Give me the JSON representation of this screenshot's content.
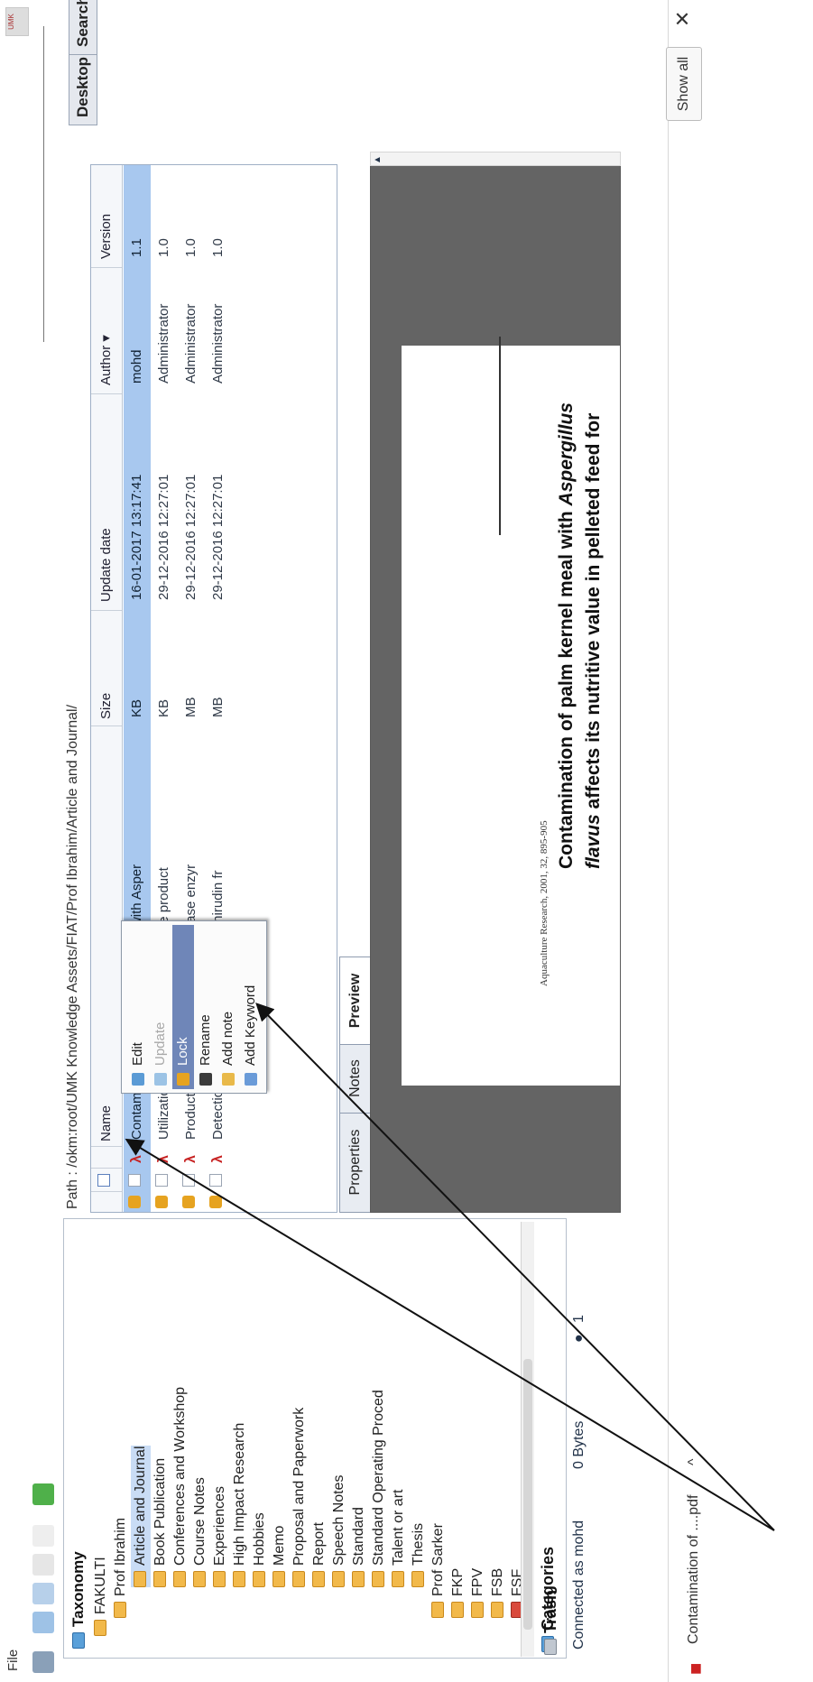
{
  "menubar": {
    "file": "File"
  },
  "topnav": {
    "desktop": "Desktop",
    "search": "Search"
  },
  "tree": {
    "title": "Taxonomy",
    "items": [
      {
        "label": "FAKULTI",
        "depth": 0
      },
      {
        "label": "Prof Ibrahim",
        "depth": 1
      },
      {
        "label": "Article and Journal",
        "depth": 2,
        "selected": true
      },
      {
        "label": "Book Publication",
        "depth": 2
      },
      {
        "label": "Conferences and Workshop",
        "depth": 2
      },
      {
        "label": "Course Notes",
        "depth": 2
      },
      {
        "label": "Experiences",
        "depth": 2
      },
      {
        "label": "High Impact Research",
        "depth": 2
      },
      {
        "label": "Hobbies",
        "depth": 2
      },
      {
        "label": "Memo",
        "depth": 2
      },
      {
        "label": "Proposal and Paperwork",
        "depth": 2
      },
      {
        "label": "Report",
        "depth": 2
      },
      {
        "label": "Speech Notes",
        "depth": 2
      },
      {
        "label": "Standard",
        "depth": 2
      },
      {
        "label": "Standard Operating Proced",
        "depth": 2
      },
      {
        "label": "Talent or art",
        "depth": 2
      },
      {
        "label": "Thesis",
        "depth": 2
      },
      {
        "label": "Prof Sarker",
        "depth": 1
      },
      {
        "label": "FKP",
        "depth": 1
      },
      {
        "label": "FPV",
        "depth": 1
      },
      {
        "label": "FSB",
        "depth": 1
      },
      {
        "label": "FSF",
        "depth": 1,
        "red": true
      }
    ],
    "categories": "Categories",
    "trash": "Trash"
  },
  "status": {
    "connected": "Connected as mohd",
    "bytes": "0 Bytes",
    "count": "1"
  },
  "path": "Path : /okm:root/UMK Knowledge Assets/FIAT/Prof Ibrahim/Article and Journal/",
  "table": {
    "headers": {
      "name": "Name",
      "size": "Size",
      "update": "Update date",
      "author": "Author ▾",
      "version": "Version"
    },
    "rows": [
      {
        "name": "Contamination of palm kernel meal with Asper",
        "size": "KB",
        "date": "16-01-2017 13:17:41",
        "author": "mohd",
        "version": "1.1",
        "selected": true
      },
      {
        "name": "Utilization of Palm kernel cake for the product",
        "size": "KB",
        "date": "29-12-2016 12:27:01",
        "author": "Administrator",
        "version": "1.0"
      },
      {
        "name": "Production and optimization of cellulase enzyr",
        "size": "MB",
        "date": "29-12-2016 12:27:01",
        "author": "Administrator",
        "version": "1.0"
      },
      {
        "name": "Detection and purification of protein hirudin fr",
        "size": "MB",
        "date": "29-12-2016 12:27:01",
        "author": "Administrator",
        "version": "1.0"
      }
    ]
  },
  "context_menu": {
    "items": [
      {
        "label": "Edit",
        "state": "normal"
      },
      {
        "label": "Update",
        "state": "disabled"
      },
      {
        "label": "Lock",
        "state": "hover"
      },
      {
        "label": "Rename",
        "state": "normal"
      },
      {
        "label": "Add note",
        "state": "normal"
      },
      {
        "label": "Add Keyword",
        "state": "normal"
      }
    ]
  },
  "bottom_tabs": {
    "properties": "Properties",
    "notes": "Notes",
    "preview": "Preview"
  },
  "preview": {
    "journal_ref": "Aquaculture Research, 2001, 32, 895-905",
    "title_part1": "Contamination of palm kernel meal with ",
    "title_italic": "Aspergillus",
    "title_line2_italic": "flavus",
    "title_part2": " affects its nutritive value in pelleted feed for"
  },
  "downloads": {
    "file": "Contamination of ....pdf",
    "chevron": "^",
    "show_all": "Show all",
    "close": "✕"
  },
  "colors": {
    "selection": "#a8c8ef",
    "menu_hover": "#6f86b8",
    "preview_bg": "#646464",
    "folder": "#f2b94a"
  }
}
